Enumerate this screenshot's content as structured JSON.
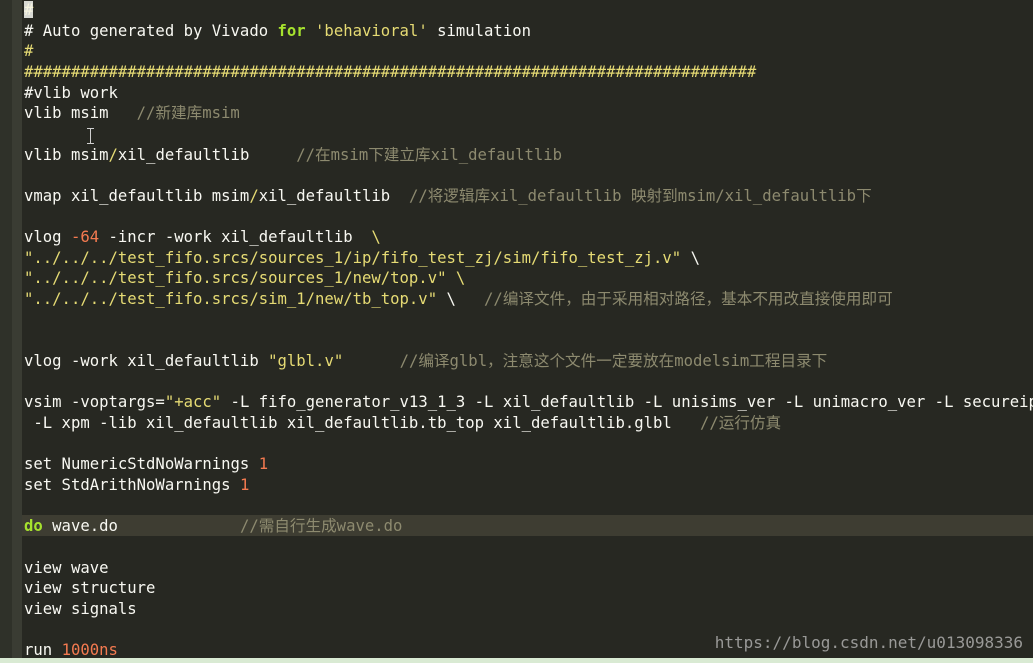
{
  "editor": {
    "language": "tcl",
    "theme": "monokai",
    "colors": {
      "background": "#272822",
      "comment": "#8d8a6f",
      "string": "#e6db74",
      "keyword": "#a6e22e",
      "number": "#f47a50",
      "text": "#f8f8f2"
    },
    "lines": [
      {
        "segments": [
          {
            "t": "#",
            "c": "yellow"
          }
        ]
      },
      {
        "segments": [
          {
            "t": "# Auto generated by Vivado ",
            "c": "plain"
          },
          {
            "t": "for",
            "c": "kw"
          },
          {
            "t": " ",
            "c": "plain"
          },
          {
            "t": "'behavioral'",
            "c": "str"
          },
          {
            "t": " simulation",
            "c": "plain"
          }
        ]
      },
      {
        "segments": [
          {
            "t": "#",
            "c": "yellow"
          }
        ]
      },
      {
        "segments": [
          {
            "t": "##############################################################################",
            "c": "yellow"
          }
        ]
      },
      {
        "segments": [
          {
            "t": "#vlib work",
            "c": "plain"
          }
        ]
      },
      {
        "segments": [
          {
            "t": "vlib msim   ",
            "c": "plain"
          },
          {
            "t": "//新建库msim",
            "c": "comment"
          }
        ]
      },
      {
        "segments": [
          {
            "t": "",
            "c": "plain"
          }
        ]
      },
      {
        "segments": [
          {
            "t": "vlib msim",
            "c": "plain"
          },
          {
            "t": "/",
            "c": "slash"
          },
          {
            "t": "xil_defaultlib     ",
            "c": "plain"
          },
          {
            "t": "//在msim下建立库xil_defaultlib",
            "c": "comment"
          }
        ]
      },
      {
        "segments": [
          {
            "t": "",
            "c": "plain"
          }
        ]
      },
      {
        "segments": [
          {
            "t": "vmap xil_defaultlib msim",
            "c": "plain"
          },
          {
            "t": "/",
            "c": "slash"
          },
          {
            "t": "xil_defaultlib  ",
            "c": "plain"
          },
          {
            "t": "//将逻辑库xil_defaultlib 映射到msim/xil_defaultlib下",
            "c": "comment"
          }
        ]
      },
      {
        "segments": [
          {
            "t": "",
            "c": "plain"
          }
        ]
      },
      {
        "segments": [
          {
            "t": "vlog ",
            "c": "plain"
          },
          {
            "t": "-64",
            "c": "num"
          },
          {
            "t": " -incr -work xil_defaultlib  ",
            "c": "plain"
          },
          {
            "t": "\\",
            "c": "bsy"
          }
        ]
      },
      {
        "segments": [
          {
            "t": "\"../../../test_fifo.srcs/sources_1/ip/fifo_test_zj/sim/fifo_test_zj.v\"",
            "c": "str"
          },
          {
            "t": " \\",
            "c": "bs"
          }
        ]
      },
      {
        "segments": [
          {
            "t": "\"../../../test_fifo.srcs/sources_1/new/top.v\"",
            "c": "str"
          },
          {
            "t": " \\",
            "c": "bsy"
          }
        ]
      },
      {
        "segments": [
          {
            "t": "\"../../../test_fifo.srcs/sim_1/new/tb_top.v\"",
            "c": "str"
          },
          {
            "t": " \\   ",
            "c": "bs"
          },
          {
            "t": "//编译文件，由于采用相对路径，基本不用改直接使用即可",
            "c": "comment"
          }
        ]
      },
      {
        "segments": [
          {
            "t": "",
            "c": "plain"
          }
        ]
      },
      {
        "segments": [
          {
            "t": "",
            "c": "plain"
          }
        ]
      },
      {
        "segments": [
          {
            "t": "vlog -work xil_defaultlib ",
            "c": "plain"
          },
          {
            "t": "\"glbl.v\"",
            "c": "str"
          },
          {
            "t": "      ",
            "c": "plain"
          },
          {
            "t": "//编译glbl，注意这个文件一定要放在modelsim工程目录下",
            "c": "comment"
          }
        ]
      },
      {
        "segments": [
          {
            "t": "",
            "c": "plain"
          }
        ]
      },
      {
        "segments": [
          {
            "t": "vsim -voptargs=",
            "c": "plain"
          },
          {
            "t": "\"+acc\"",
            "c": "str"
          },
          {
            "t": " -L fifo_generator_v13_1_3 -L xil_defaultlib -L unisims_ver -L unimacro_ver -L secureip",
            "c": "plain"
          }
        ]
      },
      {
        "segments": [
          {
            "t": " -L xpm -lib xil_defaultlib xil_defaultlib.tb_top xil_defaultlib.glbl   ",
            "c": "plain"
          },
          {
            "t": "//运行仿真",
            "c": "comment"
          }
        ]
      },
      {
        "segments": [
          {
            "t": "",
            "c": "plain"
          }
        ]
      },
      {
        "segments": [
          {
            "t": "set NumericStdNoWarnings ",
            "c": "plain"
          },
          {
            "t": "1",
            "c": "num"
          }
        ]
      },
      {
        "segments": [
          {
            "t": "set StdArithNoWarnings ",
            "c": "plain"
          },
          {
            "t": "1",
            "c": "num"
          }
        ]
      },
      {
        "segments": [
          {
            "t": "",
            "c": "plain"
          }
        ]
      },
      {
        "segments": [
          {
            "t": "do",
            "c": "kw"
          },
          {
            "t": " wave.do             ",
            "c": "plain"
          },
          {
            "t": "//需自行生成wave.do",
            "c": "comment"
          }
        ]
      },
      {
        "segments": [
          {
            "t": "",
            "c": "plain"
          }
        ]
      },
      {
        "segments": [
          {
            "t": "view wave",
            "c": "plain"
          }
        ]
      },
      {
        "segments": [
          {
            "t": "view structure",
            "c": "plain"
          }
        ]
      },
      {
        "segments": [
          {
            "t": "view signals",
            "c": "plain"
          }
        ]
      },
      {
        "segments": [
          {
            "t": "",
            "c": "plain"
          }
        ]
      },
      {
        "segments": [
          {
            "t": "run ",
            "c": "plain"
          },
          {
            "t": "1000ns",
            "c": "num"
          }
        ]
      }
    ]
  },
  "watermark": {
    "text": "https://blog.csdn.net/u013098336"
  }
}
